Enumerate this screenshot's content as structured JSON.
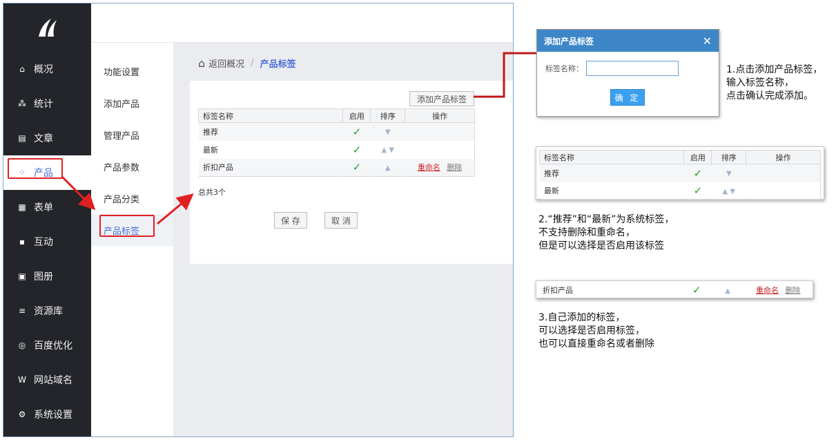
{
  "sidebar": {
    "items": [
      {
        "label": "概况",
        "icon": "home-icon",
        "glyph": "⌂"
      },
      {
        "label": "统计",
        "icon": "stats-icon",
        "glyph": "⁂"
      },
      {
        "label": "文章",
        "icon": "article-icon",
        "glyph": "▤"
      },
      {
        "label": "产品",
        "icon": "product-icon",
        "glyph": "⁘"
      },
      {
        "label": "表单",
        "icon": "form-icon",
        "glyph": "▦"
      },
      {
        "label": "互动",
        "icon": "chat-icon",
        "glyph": "▪"
      },
      {
        "label": "图册",
        "icon": "album-icon",
        "glyph": "▣"
      },
      {
        "label": "资源库",
        "icon": "database-icon",
        "glyph": "≡"
      },
      {
        "label": "百度优化",
        "icon": "seo-icon",
        "glyph": "◎"
      },
      {
        "label": "网站域名",
        "icon": "domain-icon",
        "glyph": "W"
      },
      {
        "label": "系统设置",
        "icon": "gear-icon",
        "glyph": "⚙"
      }
    ]
  },
  "subnav": {
    "items": [
      "功能设置",
      "添加产品",
      "管理产品",
      "产品参数",
      "产品分类",
      "产品标签"
    ]
  },
  "breadcrumb": {
    "back": "返回概况",
    "sep": "/",
    "current": "产品标签"
  },
  "panel": {
    "add_label": "添加产品标签",
    "headers": [
      "标签名称",
      "启用",
      "排序",
      "操作"
    ],
    "rows": [
      {
        "name": "推荐",
        "check": "✓",
        "sort": "▼",
        "rename": "",
        "delete": ""
      },
      {
        "name": "最新",
        "check": "✓",
        "sort": "▲ ▼",
        "rename": "",
        "delete": ""
      },
      {
        "name": "折扣产品",
        "check": "✓",
        "sort": "▲",
        "rename": "重命名",
        "delete": "删除"
      }
    ],
    "total": "总共3个",
    "save": "保 存",
    "cancel": "取 消"
  },
  "dialog": {
    "title": "添加产品标签",
    "close": "✕",
    "field_label": "标签名称：",
    "field_value": "",
    "ok": "确 定"
  },
  "notes": {
    "n1": [
      "1.点击添加产品标签，",
      "输入标签名称，",
      "点击确认完成添加。"
    ],
    "n2": [
      "2.“推荐”和“最新”为系统标签，",
      "不支持删除和重命名，",
      "但是可以选择是否启用该标签"
    ],
    "n3": [
      "3.自己添加的标签，",
      "可以选择是否启用标签，",
      "也可以直接重命名或者删除"
    ]
  },
  "snippet1": {
    "headers": [
      "标签名称",
      "启用",
      "排序",
      "操作"
    ],
    "rows": [
      {
        "name": "推荐",
        "check": "✓",
        "sort": "▼"
      },
      {
        "name": "最新",
        "check": "✓",
        "sort": "▲ ▼"
      }
    ]
  },
  "snippet2": {
    "name": "折扣产品",
    "check": "✓",
    "sort": "▲",
    "rename": "重命名",
    "delete": "删除"
  },
  "colors": {
    "accent": "#4a6fd6",
    "highlight": "#e02020",
    "dialog_header": "#3d87c8",
    "sidebar_bg": "#23252a"
  }
}
